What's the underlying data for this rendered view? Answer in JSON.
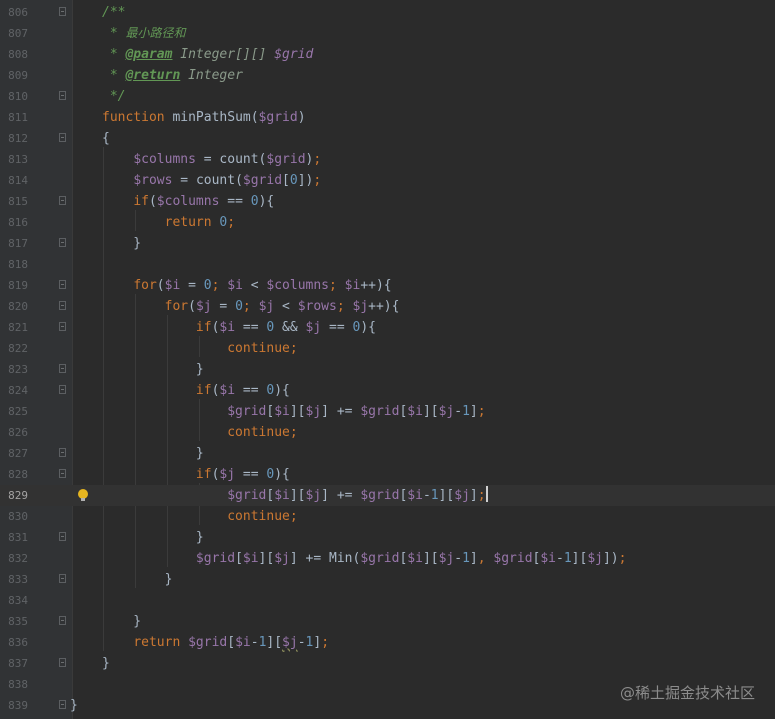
{
  "editor": {
    "line_numbers": [
      "806",
      "807",
      "808",
      "809",
      "810",
      "811",
      "812",
      "813",
      "814",
      "815",
      "816",
      "817",
      "818",
      "819",
      "820",
      "821",
      "822",
      "823",
      "824",
      "825",
      "826",
      "827",
      "828",
      "829",
      "830",
      "831",
      "832",
      "833",
      "834",
      "835",
      "836",
      "837",
      "838",
      "839"
    ],
    "current_line": "829"
  },
  "code": {
    "l806": "/**",
    "l807_star": " * ",
    "l807_text": "最小路径和",
    "l808_star": " * ",
    "l808_tag": "@param",
    "l808_type": " Integer[][] ",
    "l808_var": "$grid",
    "l809_star": " * ",
    "l809_tag": "@return",
    "l809_type": " Integer",
    "l810": " */",
    "function_kw": "function",
    "function_name": " minPathSum(",
    "var_grid": "$grid",
    "var_columns": "$columns",
    "var_rows": "$rows",
    "var_i": "$i",
    "var_j": "$j",
    "kw_if": "if",
    "kw_for": "for",
    "kw_return": "return",
    "kw_continue": "continue",
    "count": "count(",
    "min": "Min(",
    "zero": "0",
    "one": "1"
  },
  "watermark": "@稀土掘金技术社区"
}
